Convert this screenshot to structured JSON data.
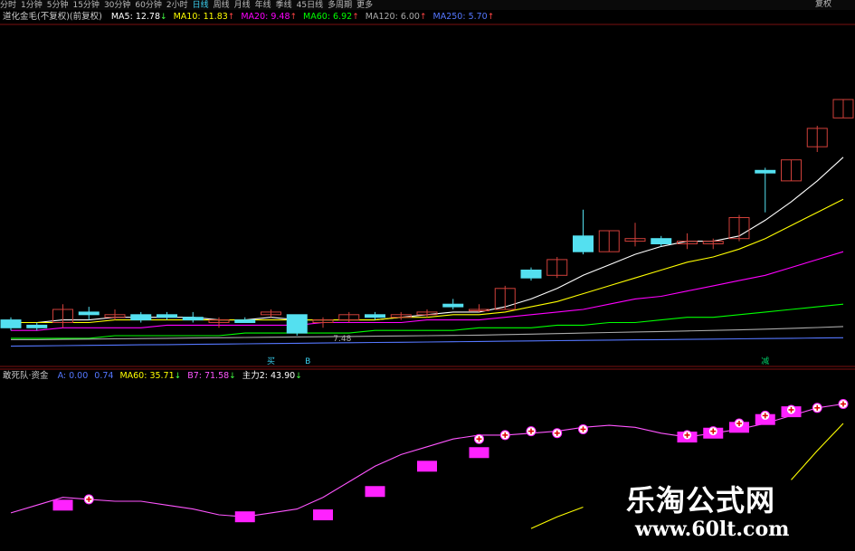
{
  "toolbar": {
    "tabs": [
      "分时",
      "1分钟",
      "5分钟",
      "15分钟",
      "30分钟",
      "60分钟",
      "2小时",
      "日线",
      "周线",
      "月线",
      "年线",
      "季线",
      "45日线",
      "多周期",
      "更多"
    ],
    "active_index": 7,
    "right_label": "复权"
  },
  "main_legend": {
    "title": "道化金毛(不复权)(前复权)",
    "items": [
      {
        "label": "MA5: 12.78",
        "color": "#ffffff",
        "arrow": "↓"
      },
      {
        "label": "MA10: 11.83",
        "color": "#ffff00",
        "arrow": "↑"
      },
      {
        "label": "MA20: 9.48",
        "color": "#ff00ff",
        "arrow": "↑"
      },
      {
        "label": "MA60: 6.92",
        "color": "#00ff00",
        "arrow": "↑"
      },
      {
        "label": "MA120: 6.00",
        "color": "#aaaaaa",
        "arrow": "↑"
      },
      {
        "label": "MA250: 5.70",
        "color": "#5577ff",
        "arrow": "↑"
      }
    ]
  },
  "sub_legend": {
    "title": "敢死队·资金",
    "items": [
      {
        "label": "A: 0.00",
        "color": "#5577ff",
        "arrow": ""
      },
      {
        "label": "0.74",
        "color": "#5577ff",
        "arrow": ""
      },
      {
        "label": "MA60: 35.71",
        "color": "#ffff00",
        "arrow": "↓"
      },
      {
        "label": "B7: 71.58",
        "color": "#ff55ff",
        "arrow": "↓"
      },
      {
        "label": "主力2: 43.90",
        "color": "#ffffff",
        "arrow": "↓"
      }
    ]
  },
  "price_tag": "7.48",
  "signal_marks": [
    {
      "text": "买",
      "color": "#3ad0f0"
    },
    {
      "text": "B",
      "color": "#3ad0f0"
    },
    {
      "text": "减",
      "color": "#00cc66"
    }
  ],
  "watermark": {
    "cn": "乐淘公式网",
    "url": "www.60lt.com"
  },
  "chart_data": [
    {
      "type": "candlestick",
      "title": "",
      "ylim": [
        4,
        14
      ],
      "candles": [
        {
          "o": 5.6,
          "h": 5.7,
          "l": 5.2,
          "c": 5.3
        },
        {
          "o": 5.4,
          "h": 5.5,
          "l": 5.2,
          "c": 5.3
        },
        {
          "o": 5.5,
          "h": 6.2,
          "l": 5.3,
          "c": 6.0
        },
        {
          "o": 5.9,
          "h": 6.1,
          "l": 5.6,
          "c": 5.8
        },
        {
          "o": 5.7,
          "h": 6.0,
          "l": 5.6,
          "c": 5.8
        },
        {
          "o": 5.8,
          "h": 5.9,
          "l": 5.5,
          "c": 5.6
        },
        {
          "o": 5.8,
          "h": 5.9,
          "l": 5.6,
          "c": 5.7
        },
        {
          "o": 5.7,
          "h": 5.9,
          "l": 5.5,
          "c": 5.6
        },
        {
          "o": 5.5,
          "h": 5.7,
          "l": 5.3,
          "c": 5.6
        },
        {
          "o": 5.6,
          "h": 5.7,
          "l": 5.5,
          "c": 5.5
        },
        {
          "o": 5.8,
          "h": 6.0,
          "l": 5.7,
          "c": 5.9
        },
        {
          "o": 5.8,
          "h": 5.8,
          "l": 5.0,
          "c": 5.1
        },
        {
          "o": 5.5,
          "h": 5.7,
          "l": 5.3,
          "c": 5.6
        },
        {
          "o": 5.6,
          "h": 5.9,
          "l": 5.5,
          "c": 5.8
        },
        {
          "o": 5.8,
          "h": 5.9,
          "l": 5.6,
          "c": 5.7
        },
        {
          "o": 5.7,
          "h": 5.9,
          "l": 5.6,
          "c": 5.8
        },
        {
          "o": 5.8,
          "h": 6.0,
          "l": 5.7,
          "c": 5.9
        },
        {
          "o": 6.2,
          "h": 6.4,
          "l": 6.0,
          "c": 6.1
        },
        {
          "o": 6.0,
          "h": 6.2,
          "l": 5.9,
          "c": 6.0
        },
        {
          "o": 6.0,
          "h": 6.9,
          "l": 6.0,
          "c": 6.8
        },
        {
          "o": 7.5,
          "h": 7.6,
          "l": 7.1,
          "c": 7.2
        },
        {
          "o": 7.3,
          "h": 8.0,
          "l": 7.2,
          "c": 7.9
        },
        {
          "o": 8.8,
          "h": 9.8,
          "l": 8.1,
          "c": 8.2
        },
        {
          "o": 8.2,
          "h": 9.0,
          "l": 8.2,
          "c": 9.0
        },
        {
          "o": 8.6,
          "h": 9.3,
          "l": 8.4,
          "c": 8.7
        },
        {
          "o": 8.7,
          "h": 8.8,
          "l": 8.4,
          "c": 8.5
        },
        {
          "o": 8.5,
          "h": 8.9,
          "l": 8.3,
          "c": 8.6
        },
        {
          "o": 8.5,
          "h": 8.7,
          "l": 8.3,
          "c": 8.6
        },
        {
          "o": 8.7,
          "h": 9.6,
          "l": 8.6,
          "c": 9.5
        },
        {
          "o": 11.3,
          "h": 11.4,
          "l": 9.7,
          "c": 11.2
        },
        {
          "o": 10.9,
          "h": 11.7,
          "l": 10.9,
          "c": 11.7
        },
        {
          "o": 12.2,
          "h": 13.0,
          "l": 12.0,
          "c": 12.9
        },
        {
          "o": 13.3,
          "h": 14.0,
          "l": 13.3,
          "c": 14.0
        }
      ],
      "series": [
        {
          "name": "MA5",
          "color": "#ffffff",
          "values": [
            5.5,
            5.5,
            5.6,
            5.6,
            5.7,
            5.7,
            5.7,
            5.7,
            5.6,
            5.6,
            5.7,
            5.6,
            5.6,
            5.6,
            5.6,
            5.7,
            5.8,
            5.9,
            5.9,
            6.1,
            6.4,
            6.8,
            7.3,
            7.7,
            8.1,
            8.4,
            8.6,
            8.6,
            8.8,
            9.4,
            10.1,
            10.9,
            11.8
          ]
        },
        {
          "name": "MA10",
          "color": "#ffff00",
          "values": [
            5.5,
            5.5,
            5.5,
            5.5,
            5.6,
            5.6,
            5.6,
            5.6,
            5.6,
            5.6,
            5.6,
            5.6,
            5.6,
            5.6,
            5.6,
            5.7,
            5.7,
            5.8,
            5.8,
            5.9,
            6.1,
            6.3,
            6.6,
            6.9,
            7.2,
            7.5,
            7.8,
            8.0,
            8.3,
            8.7,
            9.2,
            9.7,
            10.2
          ]
        },
        {
          "name": "MA20",
          "color": "#ff00ff",
          "values": [
            5.2,
            5.2,
            5.3,
            5.3,
            5.3,
            5.3,
            5.4,
            5.4,
            5.4,
            5.4,
            5.4,
            5.4,
            5.5,
            5.5,
            5.5,
            5.5,
            5.6,
            5.6,
            5.6,
            5.7,
            5.8,
            5.9,
            6.0,
            6.2,
            6.4,
            6.5,
            6.7,
            6.9,
            7.1,
            7.3,
            7.6,
            7.9,
            8.2
          ]
        },
        {
          "name": "MA60",
          "color": "#00ff00",
          "values": [
            4.9,
            4.9,
            4.9,
            4.9,
            5.0,
            5.0,
            5.0,
            5.0,
            5.0,
            5.1,
            5.1,
            5.1,
            5.1,
            5.1,
            5.2,
            5.2,
            5.2,
            5.2,
            5.3,
            5.3,
            5.3,
            5.4,
            5.4,
            5.5,
            5.5,
            5.6,
            5.7,
            5.7,
            5.8,
            5.9,
            6.0,
            6.1,
            6.2
          ]
        },
        {
          "name": "MA120",
          "color": "#aaaaaa",
          "values": [
            4.85,
            4.85,
            4.86,
            4.87,
            4.88,
            4.89,
            4.9,
            4.91,
            4.92,
            4.93,
            4.94,
            4.95,
            4.96,
            4.97,
            4.98,
            4.99,
            5.0,
            5.01,
            5.02,
            5.04,
            5.06,
            5.08,
            5.1,
            5.12,
            5.14,
            5.16,
            5.18,
            5.2,
            5.22,
            5.25,
            5.28,
            5.31,
            5.35
          ]
        },
        {
          "name": "MA250",
          "color": "#5577ff",
          "values": [
            4.6,
            4.61,
            4.62,
            4.63,
            4.64,
            4.65,
            4.66,
            4.67,
            4.68,
            4.69,
            4.7,
            4.71,
            4.72,
            4.73,
            4.74,
            4.75,
            4.76,
            4.77,
            4.78,
            4.79,
            4.8,
            4.81,
            4.82,
            4.83,
            4.84,
            4.85,
            4.86,
            4.87,
            4.88,
            4.89,
            4.9,
            4.91,
            4.92
          ]
        }
      ]
    },
    {
      "type": "line",
      "title": "",
      "ylim": [
        0,
        100
      ],
      "series": [
        {
          "name": "B7",
          "color": "#ff55ff",
          "values": [
            34,
            38,
            42,
            41,
            40,
            40,
            38,
            36,
            33,
            32,
            34,
            36,
            42,
            50,
            58,
            64,
            68,
            72,
            74,
            74,
            75,
            76,
            78,
            79,
            78,
            75,
            73,
            75,
            77,
            80,
            84,
            88,
            90
          ]
        },
        {
          "name": "MA60",
          "color": "#ffff00",
          "values": [
            null,
            null,
            null,
            null,
            null,
            null,
            null,
            null,
            null,
            null,
            null,
            null,
            null,
            null,
            null,
            null,
            null,
            null,
            null,
            null,
            26,
            32,
            37,
            null,
            null,
            null,
            null,
            null,
            null,
            null,
            51,
            66,
            80
          ]
        }
      ],
      "boxes": [
        {
          "i": 2,
          "v": 38
        },
        {
          "i": 9,
          "v": 32
        },
        {
          "i": 12,
          "v": 33
        },
        {
          "i": 14,
          "v": 45
        },
        {
          "i": 16,
          "v": 58
        },
        {
          "i": 18,
          "v": 65
        },
        {
          "i": 26,
          "v": 73
        },
        {
          "i": 27,
          "v": 75
        },
        {
          "i": 28,
          "v": 78
        },
        {
          "i": 29,
          "v": 82
        },
        {
          "i": 30,
          "v": 86
        }
      ],
      "markers": [
        {
          "i": 3,
          "v": 41
        },
        {
          "i": 18,
          "v": 72
        },
        {
          "i": 19,
          "v": 74
        },
        {
          "i": 20,
          "v": 76
        },
        {
          "i": 21,
          "v": 75
        },
        {
          "i": 22,
          "v": 77
        },
        {
          "i": 26,
          "v": 74
        },
        {
          "i": 27,
          "v": 76
        },
        {
          "i": 28,
          "v": 80
        },
        {
          "i": 29,
          "v": 84
        },
        {
          "i": 30,
          "v": 87
        },
        {
          "i": 31,
          "v": 88
        },
        {
          "i": 32,
          "v": 90
        }
      ]
    }
  ]
}
